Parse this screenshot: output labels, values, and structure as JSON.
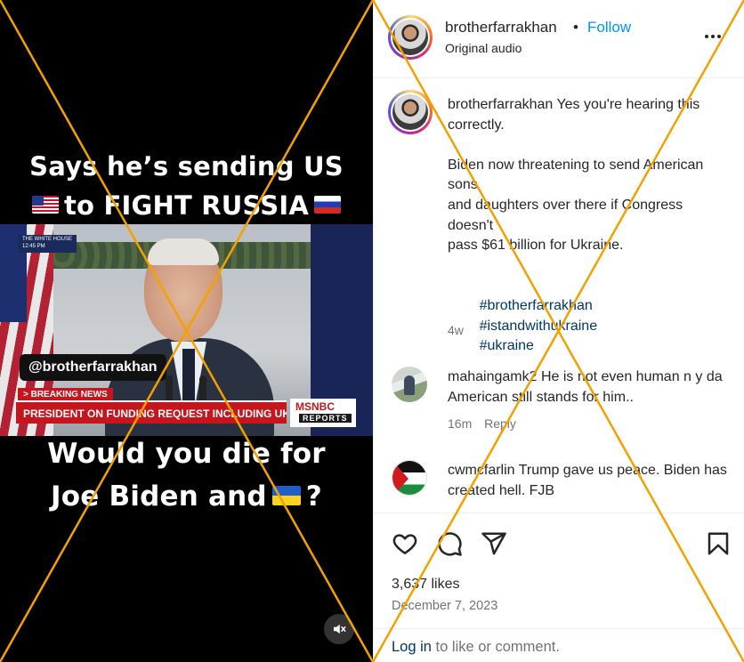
{
  "video": {
    "top_text_line1": "Says he’s sending US",
    "top_text_line2": "to FIGHT RUSSIA",
    "bottom_text_line1": "Would you die for",
    "bottom_text_line2": "Joe Biden and",
    "bottom_text_suffix": "?",
    "watermark_handle": "@brotherfarrakhan",
    "breaking_label": "> BREAKING NEWS",
    "chyron": "PRESIDENT ON FUNDING REQUEST INCLUDING UKRAINE AID",
    "network": "MSNBC",
    "network_sub": "REPORTS",
    "white_house_badge_line1": "THE WHITE HOUSE",
    "white_house_badge_line2": "12:45 PM",
    "mute_icon": "speaker-muted-icon"
  },
  "header": {
    "username": "brotherfarrakhan",
    "separator": "•",
    "follow_label": "Follow",
    "subtitle": "Original audio",
    "more_icon": "more-options-icon"
  },
  "caption": {
    "username": "brotherfarrakhan",
    "text_line1": " Yes you're hearing this correctly.",
    "body": "Biden now threatening to send American sons\nand daughters over there if Congress doesn't\npass $61 billion for Ukraine.",
    "hashtags": [
      "#brotherfarrakhan",
      "#istandwithukraine",
      "#ukraine"
    ],
    "timestamp": "4w"
  },
  "comments": [
    {
      "username": "mahaingamk2",
      "text": " He is not even human n y da American still stands for him..",
      "time": "16m",
      "reply_label": "Reply"
    },
    {
      "username": "cwmcfarlin",
      "text": " Trump gave us peace. Biden has created hell. FJB"
    }
  ],
  "actions": {
    "like_icon": "heart-icon",
    "comment_icon": "comment-bubble-icon",
    "share_icon": "paper-plane-icon",
    "save_icon": "bookmark-icon"
  },
  "likes": "3,637 likes",
  "date": "December 7, 2023",
  "login": {
    "link": "Log in",
    "rest": " to like or comment."
  },
  "colors": {
    "follow_blue": "#0095f6",
    "hashtag_blue": "#00376b",
    "cross_orange": "#f4a100",
    "chyron_red": "#c4161c"
  }
}
